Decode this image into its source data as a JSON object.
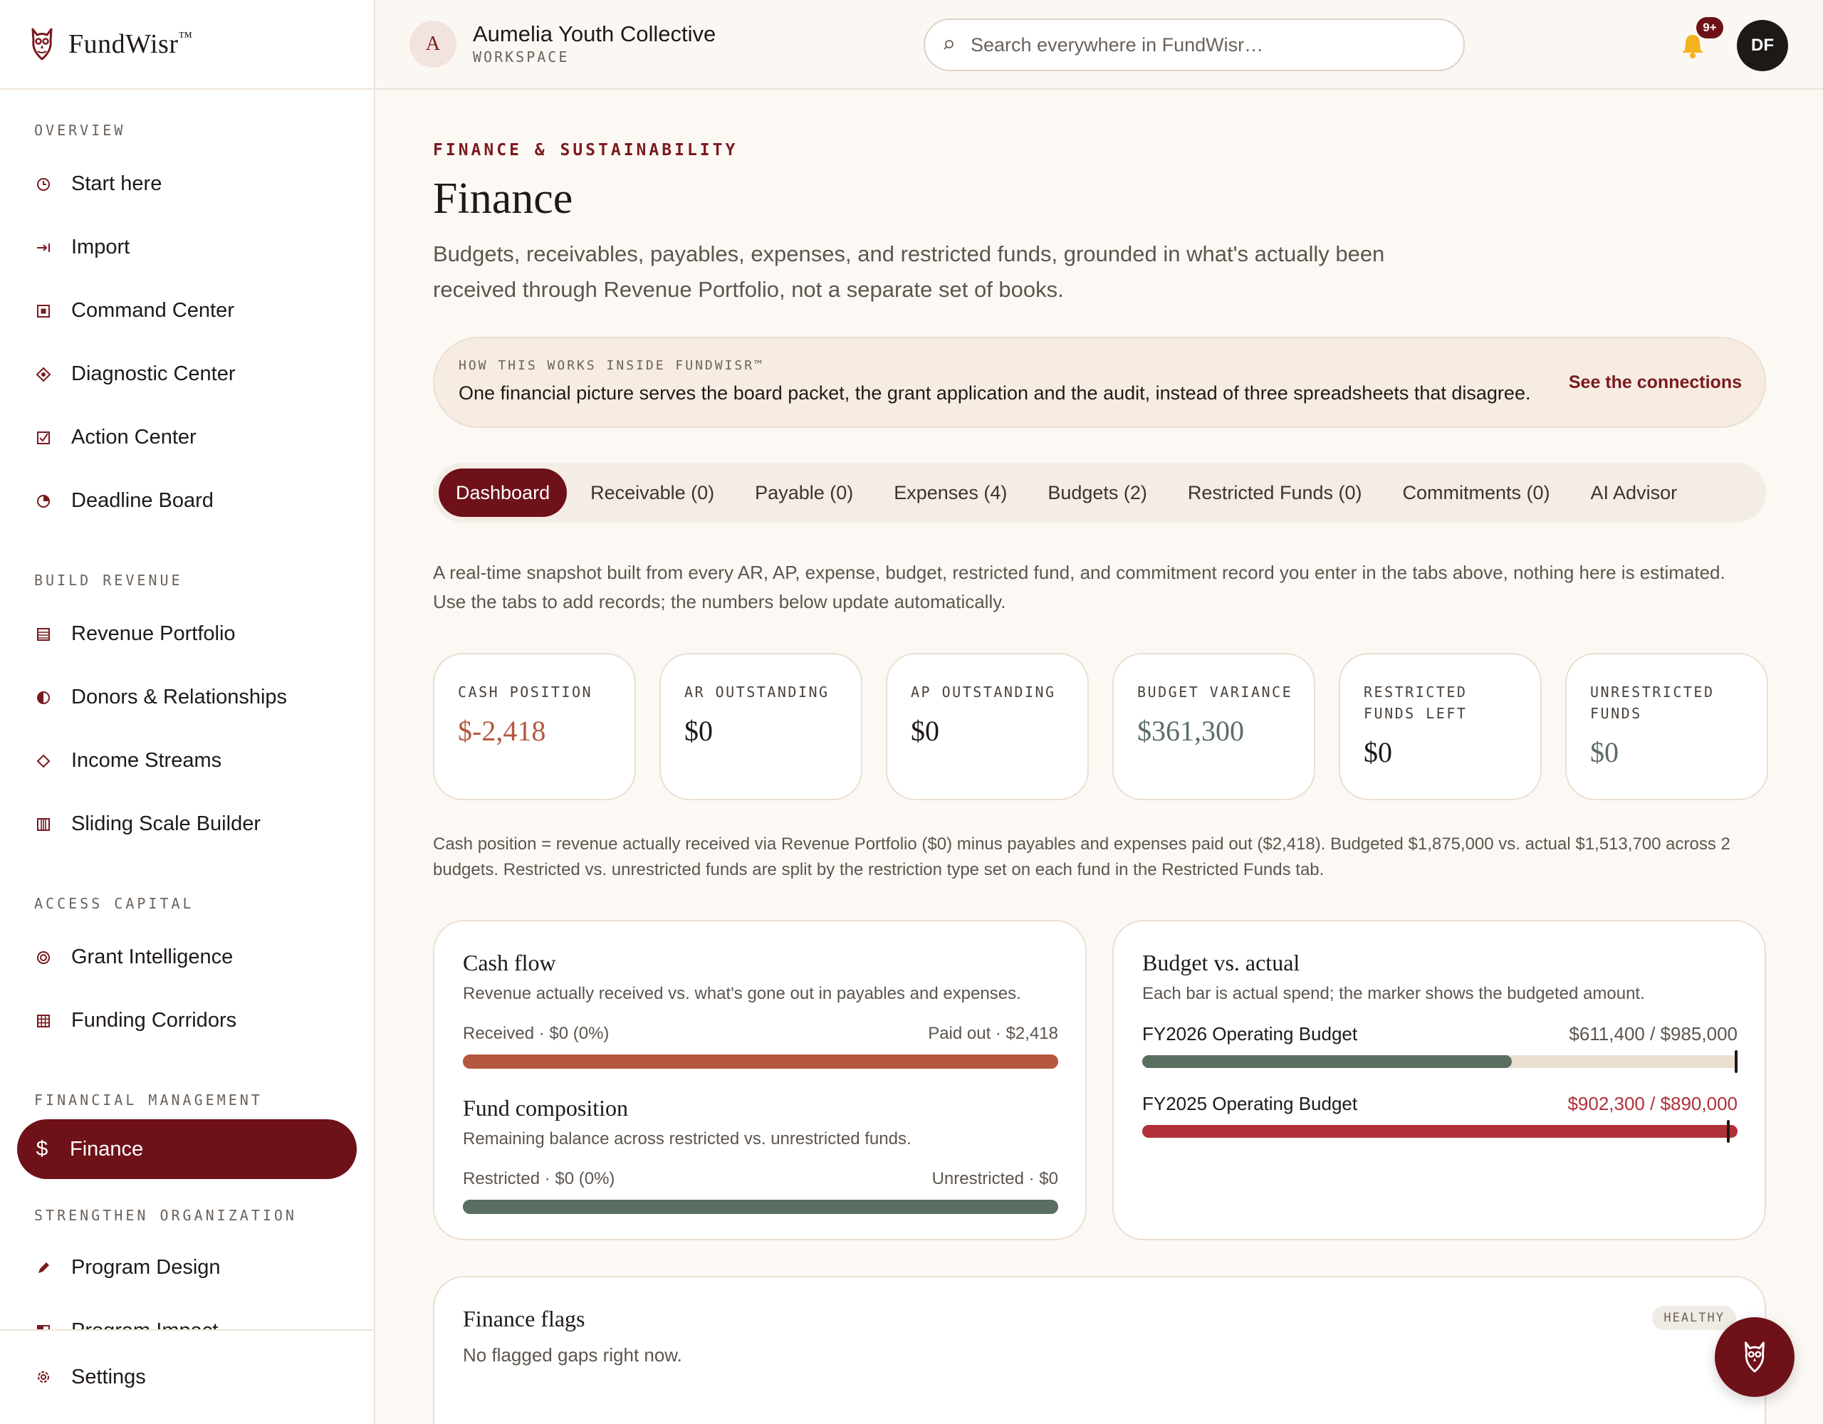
{
  "brand": {
    "name": "FundWisr",
    "tm": "™"
  },
  "sidebar": {
    "sections": [
      {
        "title": "OVERVIEW",
        "items": [
          {
            "label": "Start here",
            "icon": "clock-icon"
          },
          {
            "label": "Import",
            "icon": "import-arrow-icon"
          },
          {
            "label": "Command Center",
            "icon": "square-target-icon"
          },
          {
            "label": "Diagnostic Center",
            "icon": "diamond-dot-icon"
          },
          {
            "label": "Action Center",
            "icon": "checkbox-icon"
          },
          {
            "label": "Deadline Board",
            "icon": "pie-clock-icon"
          }
        ]
      },
      {
        "title": "BUILD REVENUE",
        "items": [
          {
            "label": "Revenue Portfolio",
            "icon": "list-icon"
          },
          {
            "label": "Donors & Relationships",
            "icon": "half-circle-icon"
          },
          {
            "label": "Income Streams",
            "icon": "diamond-icon"
          },
          {
            "label": "Sliding Scale Builder",
            "icon": "columns-icon"
          }
        ]
      },
      {
        "title": "ACCESS CAPITAL",
        "items": [
          {
            "label": "Grant Intelligence",
            "icon": "target-icon"
          },
          {
            "label": "Funding Corridors",
            "icon": "grid-icon"
          }
        ]
      },
      {
        "title": "FINANCIAL MANAGEMENT",
        "items": [
          {
            "label": "Finance",
            "icon": "dollar-icon",
            "active": true
          }
        ]
      },
      {
        "title": "STRENGTHEN ORGANIZATION",
        "items": [
          {
            "label": "Program Design",
            "icon": "pencil-icon"
          },
          {
            "label": "Program Impact",
            "icon": "half-square-icon"
          }
        ]
      }
    ],
    "footer": {
      "label": "Settings",
      "icon": "gear-icon"
    }
  },
  "topbar": {
    "workspace_initial": "A",
    "workspace_name": "Aumelia Youth Collective",
    "workspace_sub": "WORKSPACE",
    "search_placeholder": "Search everywhere in FundWisr…",
    "notif_count": "9+",
    "user_initials": "DF"
  },
  "page": {
    "eyebrow": "FINANCE & SUSTAINABILITY",
    "title": "Finance",
    "description": "Budgets, receivables, payables, expenses, and restricted funds, grounded in what's actually been received through Revenue Portfolio, not a separate set of books."
  },
  "howbox": {
    "label": "HOW THIS WORKS INSIDE FUNDWISR™",
    "text": "One financial picture serves the board packet, the grant application and the audit, instead of three spreadsheets that disagree.",
    "link": "See the connections"
  },
  "tabs": [
    {
      "label": "Dashboard",
      "active": true
    },
    {
      "label": "Receivable (0)"
    },
    {
      "label": "Payable (0)"
    },
    {
      "label": "Expenses (4)"
    },
    {
      "label": "Budgets (2)"
    },
    {
      "label": "Restricted Funds (0)"
    },
    {
      "label": "Commitments (0)"
    },
    {
      "label": "AI Advisor"
    }
  ],
  "snapshot_desc": "A real-time snapshot built from every AR, AP, expense, budget, restricted fund, and commitment record you enter in the tabs above, nothing here is estimated. Use the tabs to add records; the numbers below update automatically.",
  "kpis": [
    {
      "label": "CASH POSITION",
      "value": "$-2,418",
      "color": "#b5583f"
    },
    {
      "label": "AR OUTSTANDING",
      "value": "$0",
      "color": "#1f1a17"
    },
    {
      "label": "AP OUTSTANDING",
      "value": "$0",
      "color": "#1f1a17"
    },
    {
      "label": "BUDGET VARIANCE",
      "value": "$361,300",
      "color": "#5a6e62"
    },
    {
      "label": "RESTRICTED FUNDS LEFT",
      "value": "$0",
      "color": "#1f1a17"
    },
    {
      "label": "UNRESTRICTED FUNDS",
      "value": "$0",
      "color": "#5a6e62"
    }
  ],
  "cash_note": "Cash position = revenue actually received via Revenue Portfolio ($0) minus payables and expenses paid out ($2,418). Budgeted $1,875,000 vs. actual $1,513,700 across 2 budgets. Restricted vs. unrestricted funds are split by the restriction type set on each fund in the Restricted Funds tab.",
  "cash_flow": {
    "title": "Cash flow",
    "subtitle": "Revenue actually received vs. what's gone out in payables and expenses.",
    "left_label": "Received · $0 (0%)",
    "right_label": "Paid out · $2,418",
    "received_fraction": 0,
    "colors": {
      "received": "#5a6e62",
      "paid": "#b5583f"
    }
  },
  "fund_composition": {
    "title": "Fund composition",
    "subtitle": "Remaining balance across restricted vs. unrestricted funds.",
    "left_label": "Restricted · $0 (0%)",
    "right_label": "Unrestricted · $0",
    "restricted_fraction": 0,
    "colors": {
      "restricted": "#b5583f",
      "unrestricted": "#5a6e62"
    }
  },
  "budget_vs_actual": {
    "title": "Budget vs. actual",
    "subtitle": "Each bar is actual spend; the marker shows the budgeted amount.",
    "rows": [
      {
        "name": "FY2026 Operating Budget",
        "amount": "$611,400 / $985,000",
        "actual": 611400,
        "budget": 985000,
        "over": false
      },
      {
        "name": "FY2025 Operating Budget",
        "amount": "$902,300 / $890,000",
        "actual": 902300,
        "budget": 890000,
        "over": true
      }
    ],
    "colors": {
      "under": "#5a6e62",
      "over": "#b0313a",
      "over_text": "#b0313a"
    }
  },
  "flags": {
    "title": "Finance flags",
    "badge": "HEALTHY",
    "text": "No flagged gaps right now."
  }
}
